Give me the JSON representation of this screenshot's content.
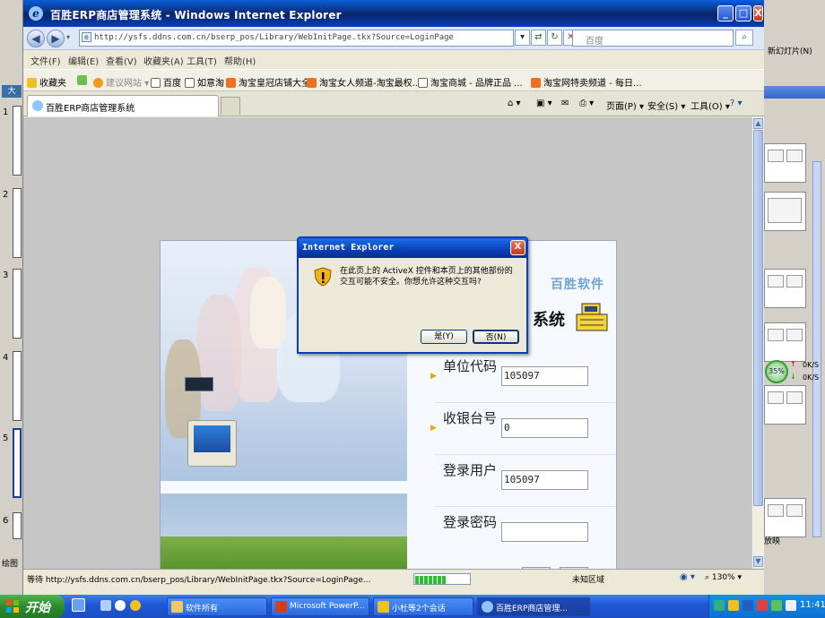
{
  "ppt": {
    "slide_numbers": [
      "1",
      "2",
      "3",
      "4",
      "5",
      "6"
    ],
    "left_tab": "大",
    "new_slide_label": "新幻灯片(N)",
    "slideshow_label": "放映",
    "draw_label": "绘图"
  },
  "window": {
    "title": "百胜ERP商店管理系统 - Windows Internet Explorer",
    "minimize": "_",
    "maximize": "□",
    "close": "X"
  },
  "address": {
    "url": "http://ysfs.ddns.com.cn/bserp_pos/Library/WebInitPage.tkx?Source=LoginPage",
    "search_placeholder": "百度"
  },
  "menu": [
    "文件(F)",
    "编辑(E)",
    "查看(V)",
    "收藏夹(A)",
    "工具(T)",
    "帮助(H)"
  ],
  "favorites": {
    "label": "收藏夹",
    "items": [
      "建议网站 ▾",
      "百度",
      "如意淘",
      "淘宝皇冠店铺大全",
      "淘宝女人频道-淘宝最权...",
      "淘宝商城 - 品牌正品 ...",
      "淘宝网特卖频道 - 每日..."
    ]
  },
  "tab": {
    "title": "百胜ERP商店管理系统"
  },
  "commands": {
    "page": "页面(P) ▾",
    "safety": "安全(S) ▾",
    "tools": "工具(O) ▾"
  },
  "login": {
    "brand": "百胜软件",
    "system_title": "系统",
    "fields": [
      {
        "label": "单位代码",
        "value": "105097"
      },
      {
        "label": "收银台号",
        "value": "0"
      },
      {
        "label": "登录用户",
        "value": "105097"
      },
      {
        "label": "登录密码",
        "value": ""
      }
    ]
  },
  "dialog": {
    "title": "Internet Explorer",
    "message": "在此页上的 ActiveX 控件和本页上的其他部份的交互可能不安全。你想允许这种交互吗?",
    "yes": "是(Y)",
    "no": "否(N)"
  },
  "status": {
    "text": "等待 http://ysfs.ddns.com.cn/bserp_pos/Library/WebInitPage.tkx?Source=LoginPage...",
    "zone": "未知区域",
    "zoom": "130%",
    "progress_fraction": 0.55
  },
  "taskbar": {
    "start": "开始",
    "tasks": [
      "软件所有",
      "Microsoft PowerP...",
      "小杜等2个会话",
      "百胜ERP商店管理..."
    ],
    "clock": "11:41"
  },
  "widget": {
    "percent": "35%",
    "up": "0K/S",
    "down": "0K/S"
  },
  "colors": {
    "title_bar": "#0a246a",
    "taskbar": "#1f58d8",
    "start": "#2e8b2e",
    "brand": "#6fa3d6"
  }
}
